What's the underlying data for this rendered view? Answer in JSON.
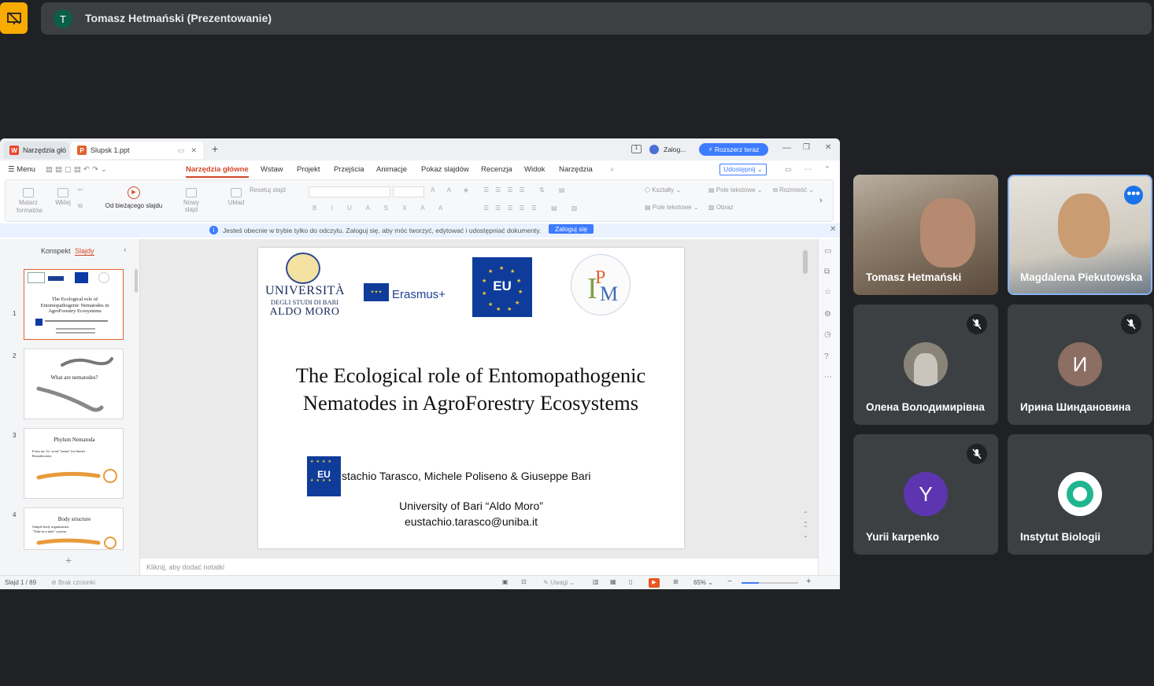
{
  "meeting": {
    "presenter_initial": "T",
    "presenter_title": "Tomasz Hetmański (Prezentowanie)"
  },
  "app": {
    "tabs": [
      {
        "label": "Narzędzia głó",
        "icon": "wps-icon"
      },
      {
        "label": "Slupsk 1.ppt",
        "icon": "presentation-icon"
      }
    ],
    "login_label": "Zalog...",
    "expand_label": "Rozszerz teraz",
    "menu_label": "Menu",
    "menus": [
      "Narzędzia główne",
      "Wstaw",
      "Projekt",
      "Przejścia",
      "Animacje",
      "Pokaz slajdów",
      "Recenzja",
      "Widok",
      "Narzędzia"
    ],
    "share_label": "Udostępnij",
    "ribbon": {
      "painter": "Malarz formatów",
      "paste": "Wklej",
      "from_current": "Od bieżącego slajdu",
      "new_slide": "Nowy slajd",
      "layout": "Układ",
      "reset_slide": "Resetuj slajd",
      "shapes": "Kształty",
      "text_box": "Pole tekstowe",
      "arrange": "Rozmieść",
      "text_box2": "Pole tekstowe",
      "picture": "Obraz"
    },
    "info_message": "Jesteś obecnie w trybie tylko do odczytu. Zaloguj się, aby móc tworzyć, edytować i udostępniać dokumenty.",
    "info_login": "Zaloguj się",
    "panel_tabs": [
      "Konspekt",
      "Slajdy"
    ],
    "thumbnails": [
      {
        "num": "1",
        "title": "The Ecological role of Entomopathogenic Nematodes in AgroForestry Ecosystems"
      },
      {
        "num": "2",
        "title": "What are nematodes?"
      },
      {
        "num": "3",
        "title": "Phylum Nematoda",
        "bullets": [
          "From an. Gr. word \"nema\" for thread",
          "Roundworms"
        ]
      },
      {
        "num": "4",
        "title": "Body structure",
        "bullets": [
          "Simple body organization",
          "\"Tube in a tube\" system"
        ]
      }
    ],
    "slide": {
      "logo1_line1": "UNIVERSITÀ",
      "logo1_line2": "DEGLI STUDI DI BARI",
      "logo1_line3": "ALDO MORO",
      "erasmus": "Erasmus+",
      "eu": "EU",
      "title": "The Ecological role of Entomopathogenic Nematodes in AgroForestry Ecosystems",
      "authors": "stachio Tarasco, Michele Poliseno & Giuseppe Bari",
      "university": "University of Bari “Aldo Moro”",
      "email": "eustachio.tarasco@uniba.it"
    },
    "notes_placeholder": "Kliknij, aby dodać notatki",
    "status": {
      "slide": "Slajd 1 / 89",
      "fonts": "Brak czcionki",
      "comments": "Uwagi",
      "zoom": "65%"
    }
  },
  "participants": [
    {
      "name": "Tomasz Hetmański",
      "type": "video"
    },
    {
      "name": "Magdalena Piekutowska",
      "type": "video"
    },
    {
      "name": "Олена Володимирівна",
      "type": "photo",
      "muted": true
    },
    {
      "name": "Ирина Шиндановина",
      "initial": "И",
      "color": "#8d6e63",
      "muted": true
    },
    {
      "name": "Yurii karpenko",
      "initial": "Y",
      "color": "#5e35b1",
      "muted": true
    },
    {
      "name": "Instytut Biologii",
      "type": "logo"
    }
  ]
}
